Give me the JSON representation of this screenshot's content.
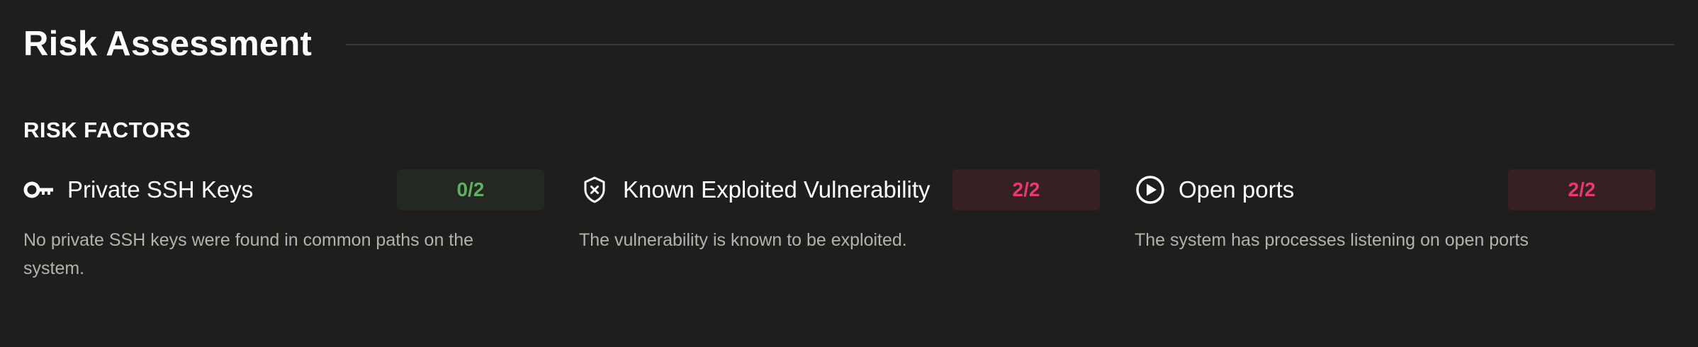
{
  "header": {
    "title": "Risk Assessment"
  },
  "section": {
    "heading": "RISK FACTORS"
  },
  "factors": [
    {
      "icon": "key-icon",
      "title": "Private SSH Keys",
      "score": "0/2",
      "status": "good",
      "description": "No private SSH keys were found in common paths on the system."
    },
    {
      "icon": "shield-x-icon",
      "title": "Known Exploited Vulnerability",
      "score": "2/2",
      "status": "bad",
      "description": "The vulnerability is known to be exploited."
    },
    {
      "icon": "play-circle-icon",
      "title": "Open ports",
      "score": "2/2",
      "status": "bad",
      "description": "The system has processes listening on open ports"
    }
  ],
  "colors": {
    "background": "#1f1e1d",
    "good": "#5fae62",
    "good_bg": "#232823",
    "bad": "#e73a72",
    "bad_bg": "#362024",
    "muted_text": "#b4b2af"
  }
}
